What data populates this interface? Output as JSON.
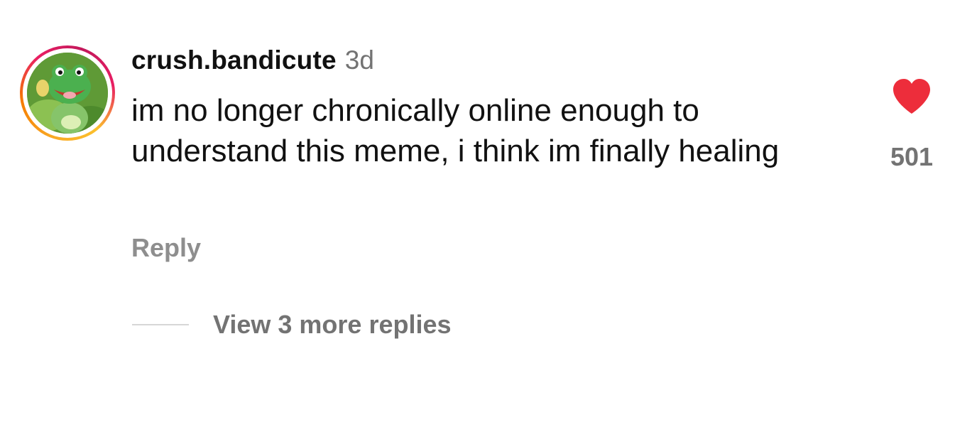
{
  "comment": {
    "username": "crush.bandicute",
    "timestamp": "3d",
    "text": "im no longer chronically online enough to understand this meme, i think im finally healing",
    "reply_label": "Reply",
    "like_count": "501",
    "liked": true,
    "view_replies_label": "View 3 more replies"
  },
  "colors": {
    "heart": "#ed2d3b",
    "secondary_text": "#737373",
    "story_ring": [
      "#f9a825",
      "#e91e63"
    ]
  },
  "icons": {
    "avatar": "frog-cartoon-avatar",
    "like": "heart-filled-icon"
  }
}
